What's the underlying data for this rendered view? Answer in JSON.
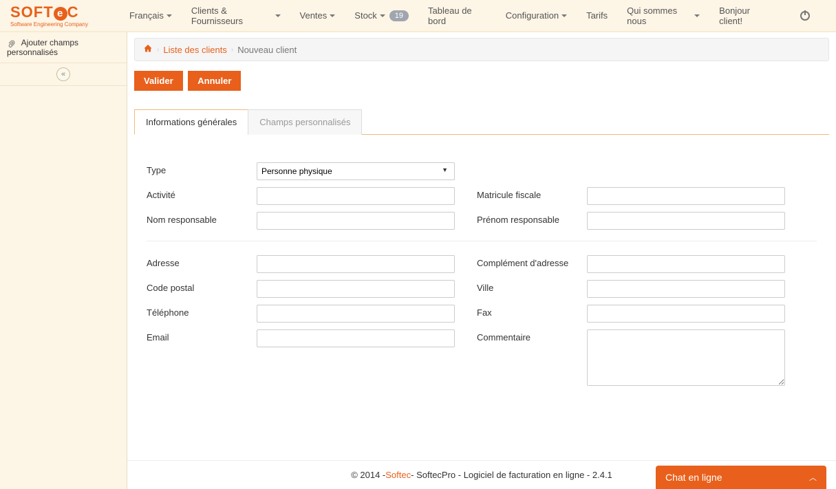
{
  "logo": {
    "text": "SOFTEC",
    "sub": "Software Engineering Company"
  },
  "nav": {
    "lang": "Français",
    "clients": "Clients & Fournisseurs",
    "ventes": "Ventes",
    "stock": "Stock",
    "stock_badge": "19",
    "dashboard": "Tableau de bord",
    "config": "Configuration",
    "tarifs": "Tarifs",
    "about": "Qui sommes nous",
    "greeting": "Bonjour client!"
  },
  "sidebar": {
    "add_custom": "Ajouter champs personnalisés"
  },
  "breadcrumb": {
    "list": "Liste des clients",
    "current": "Nouveau client"
  },
  "actions": {
    "validate": "Valider",
    "cancel": "Annuler"
  },
  "tabs": {
    "general": "Informations générales",
    "custom": "Champs personnalisés"
  },
  "form": {
    "type_label": "Type",
    "type_value": "Personne physique",
    "activite": "Activité",
    "matricule": "Matricule fiscale",
    "nom_resp": "Nom responsable",
    "prenom_resp": "Prénom responsable",
    "adresse": "Adresse",
    "complement": "Complément d'adresse",
    "cp": "Code postal",
    "ville": "Ville",
    "tel": "Téléphone",
    "fax": "Fax",
    "email": "Email",
    "commentaire": "Commentaire"
  },
  "footer": {
    "copyright_pre": "© 2014 - ",
    "softec": "Softec",
    "rest": " - SoftecPro - Logiciel de facturation en ligne - 2.4.1"
  },
  "chat": "Chat en ligne"
}
